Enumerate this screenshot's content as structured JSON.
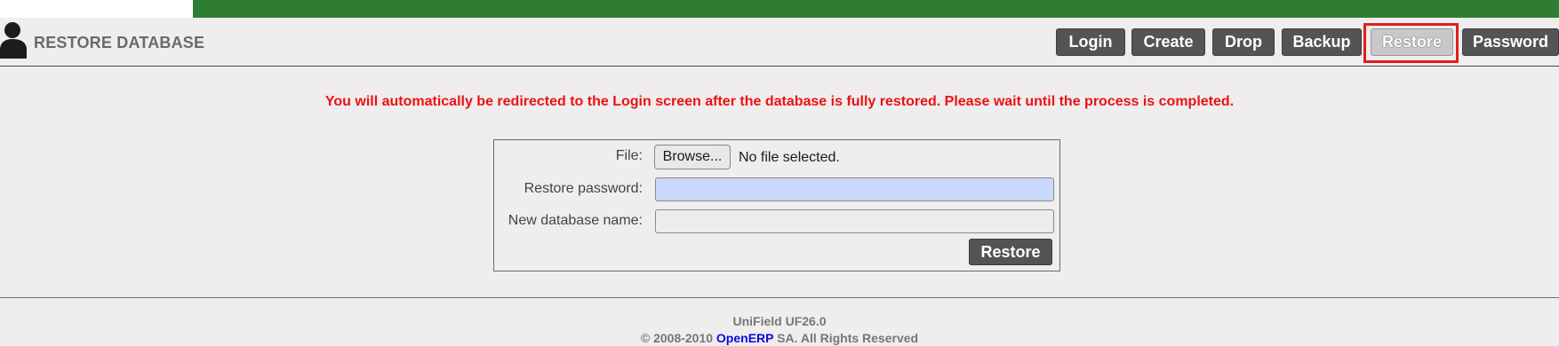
{
  "header": {
    "title": "RESTORE DATABASE",
    "nav": {
      "login": "Login",
      "create": "Create",
      "drop": "Drop",
      "backup": "Backup",
      "restore": "Restore",
      "password": "Password"
    },
    "active_nav": "Restore"
  },
  "notice": "You will automatically be redirected to the Login screen after the database is fully restored. Please wait until the process is completed.",
  "form": {
    "file_label": "File:",
    "browse_label": "Browse...",
    "file_status": "No file selected.",
    "restore_password_label": "Restore password:",
    "restore_password_value": "",
    "new_db_name_label": "New database name:",
    "new_db_name_value": "",
    "submit_label": "Restore"
  },
  "footer": {
    "version": "UniField UF26.0",
    "copyright_prefix": "© 2008-2010",
    "link_text": "OpenERP",
    "copyright_suffix": "SA. All Rights Reserved"
  },
  "colors": {
    "top_bar": "#2e7d32",
    "notice": "#ee1111",
    "button": "#545454",
    "active_button": "#c8c8c8",
    "highlight": "#e01e1e",
    "password_field": "#c9d8fb",
    "link": "#0a0adf"
  },
  "icons": {
    "user": "user-silhouette-icon"
  }
}
